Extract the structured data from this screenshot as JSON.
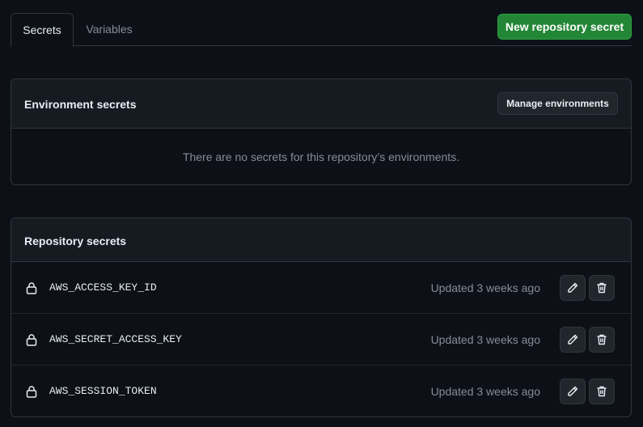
{
  "tabs": [
    {
      "label": "Secrets",
      "selected": true
    },
    {
      "label": "Variables",
      "selected": false
    }
  ],
  "actions": {
    "new_secret_label": "New repository secret"
  },
  "environment": {
    "title": "Environment secrets",
    "manage_label": "Manage environments",
    "empty_message": "There are no secrets for this repository’s environments."
  },
  "repository": {
    "title": "Repository secrets",
    "secrets": [
      {
        "name": "AWS_ACCESS_KEY_ID",
        "updated": "Updated 3 weeks ago"
      },
      {
        "name": "AWS_SECRET_ACCESS_KEY",
        "updated": "Updated 3 weeks ago"
      },
      {
        "name": "AWS_SESSION_TOKEN",
        "updated": "Updated 3 weeks ago"
      }
    ]
  },
  "icons": {
    "lock": "lock-icon",
    "edit": "pencil-icon",
    "delete": "trash-icon"
  },
  "colors": {
    "primary": "#238636",
    "background": "#0d1117",
    "border": "#30363d",
    "muted": "#848d97"
  }
}
